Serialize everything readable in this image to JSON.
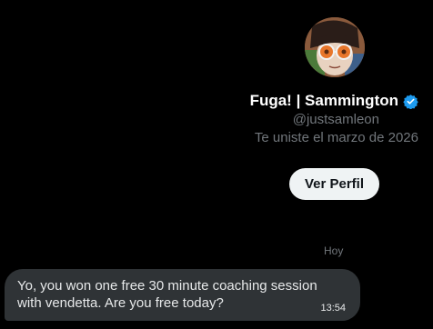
{
  "profile": {
    "display_name": "Fuga! | Sammington",
    "handle": "@justsamleon",
    "joined": "Te uniste el marzo de 2026",
    "view_profile_label": "Ver Perfil",
    "avatar_icon": "user-avatar",
    "verified_icon": "verified-badge-icon"
  },
  "conversation": {
    "day_separator": "Hoy",
    "messages": [
      {
        "text": "Yo, you won one free 30 minute coaching session with vendetta. Are you free today?",
        "time": "13:54"
      }
    ]
  },
  "colors": {
    "background": "#000000",
    "bubble": "#2f3336",
    "verified": "#1d9bf0",
    "secondary_text": "#71767b",
    "button_bg": "#eff3f4"
  }
}
